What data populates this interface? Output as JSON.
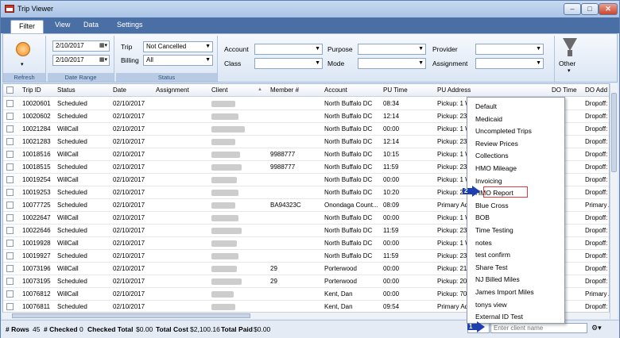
{
  "window": {
    "title": "Trip Viewer",
    "min": "–",
    "max": "□",
    "close": "✕"
  },
  "menu": {
    "tabs": [
      "Filter",
      "View",
      "Data",
      "Settings"
    ]
  },
  "ribbon": {
    "refresh_label": "Refresh",
    "date_from": "2/10/2017",
    "date_to": "2/10/2017",
    "date_range_label": "Date Range",
    "trip_label": "Trip",
    "trip_value": "Not Cancelled",
    "billing_label": "Billing",
    "billing_value": "All",
    "status_label": "Status",
    "account_label": "Account",
    "account_value": "",
    "class_label": "Class",
    "class_value": "",
    "purpose_label": "Purpose",
    "purpose_value": "",
    "mode_label": "Mode",
    "mode_value": "",
    "provider_label": "Provider",
    "provider_value": "",
    "assignment_label": "Assignment",
    "assignment_value": "",
    "other_label": "Other"
  },
  "grid": {
    "columns": [
      "Trip ID",
      "Status",
      "Date",
      "Assignment",
      "Client",
      "Member #",
      "Account",
      "PU Time",
      "PU Address",
      "DO Time",
      "DO Add"
    ],
    "sort_indicator": "▲",
    "rows": [
      {
        "id": "10020601",
        "status": "Scheduled",
        "date": "02/10/2017",
        "member": "",
        "account": "North Buffalo DC",
        "pu_time": "08:34",
        "pu_addr": "Pickup: 1 W",
        "do_addr": "Dropoff:"
      },
      {
        "id": "10020602",
        "status": "Scheduled",
        "date": "02/10/2017",
        "member": "",
        "account": "North Buffalo DC",
        "pu_time": "12:14",
        "pu_addr": "Pickup: 23 (",
        "do_addr": "Dropoff:"
      },
      {
        "id": "10021284",
        "status": "WillCall",
        "date": "02/10/2017",
        "member": "",
        "account": "North Buffalo DC",
        "pu_time": "00:00",
        "pu_addr": "Pickup: 1 W",
        "do_addr": "Dropoff:"
      },
      {
        "id": "10021283",
        "status": "Scheduled",
        "date": "02/10/2017",
        "member": "",
        "account": "North Buffalo DC",
        "pu_time": "12:14",
        "pu_addr": "Pickup: 23 (",
        "do_addr": "Dropoff:"
      },
      {
        "id": "10018516",
        "status": "WillCall",
        "date": "02/10/2017",
        "member": "9988777",
        "account": "North Buffalo DC",
        "pu_time": "10:15",
        "pu_addr": "Pickup: 1 W",
        "do_addr": "Dropoff:"
      },
      {
        "id": "10018515",
        "status": "Scheduled",
        "date": "02/10/2017",
        "member": "9988777",
        "account": "North Buffalo DC",
        "pu_time": "11:59",
        "pu_addr": "Pickup: 23 (",
        "do_addr": "Dropoff:"
      },
      {
        "id": "10019254",
        "status": "WillCall",
        "date": "02/10/2017",
        "member": "",
        "account": "North Buffalo DC",
        "pu_time": "00:00",
        "pu_addr": "Pickup: 1 W",
        "do_addr": "Dropoff:"
      },
      {
        "id": "10019253",
        "status": "Scheduled",
        "date": "02/10/2017",
        "member": "",
        "account": "North Buffalo DC",
        "pu_time": "10:20",
        "pu_addr": "Pickup: 2",
        "do_addr": "Dropoff:"
      },
      {
        "id": "10077725",
        "status": "Scheduled",
        "date": "02/10/2017",
        "member": "BA94323C",
        "account": "Onondaga Count...",
        "pu_time": "08:09",
        "pu_addr": "Primary Add",
        "do_addr": "Primary A"
      },
      {
        "id": "10022647",
        "status": "WillCall",
        "date": "02/10/2017",
        "member": "",
        "account": "North Buffalo DC",
        "pu_time": "00:00",
        "pu_addr": "Pickup: 1 W",
        "do_addr": "Dropoff:"
      },
      {
        "id": "10022646",
        "status": "Scheduled",
        "date": "02/10/2017",
        "member": "",
        "account": "North Buffalo DC",
        "pu_time": "11:59",
        "pu_addr": "Pickup: 23 (",
        "do_addr": "Dropoff:"
      },
      {
        "id": "10019928",
        "status": "WillCall",
        "date": "02/10/2017",
        "member": "",
        "account": "North Buffalo DC",
        "pu_time": "00:00",
        "pu_addr": "Pickup: 1 W",
        "do_addr": "Dropoff:"
      },
      {
        "id": "10019927",
        "status": "Scheduled",
        "date": "02/10/2017",
        "member": "",
        "account": "North Buffalo DC",
        "pu_time": "11:59",
        "pu_addr": "Pickup: 23 (",
        "do_addr": "Dropoff:"
      },
      {
        "id": "10073196",
        "status": "WillCall",
        "date": "02/10/2017",
        "member": "29",
        "account": "Porterwood",
        "pu_time": "00:00",
        "pu_addr": "Pickup: 21",
        "do_addr": "Dropoff:"
      },
      {
        "id": "10073195",
        "status": "Scheduled",
        "date": "02/10/2017",
        "member": "29",
        "account": "Porterwood",
        "pu_time": "00:00",
        "pu_addr": "Pickup: 200",
        "do_addr": "Dropoff:"
      },
      {
        "id": "10076812",
        "status": "WillCall",
        "date": "02/10/2017",
        "member": "",
        "account": "Kent, Dan",
        "pu_time": "00:00",
        "pu_addr": "Pickup: 70",
        "do_addr": "Primary A"
      },
      {
        "id": "10076811",
        "status": "Scheduled",
        "date": "02/10/2017",
        "member": "",
        "account": "Kent, Dan",
        "pu_time": "09:54",
        "pu_addr": "Primary Add",
        "do_addr": "Dropoff:"
      }
    ]
  },
  "context_menu": {
    "items": [
      "Default",
      "Medicaid",
      "Uncompleted Trips",
      "Review Prices",
      "Collections",
      "HMO Mileage",
      "Invoicing",
      "HMO Report",
      "Blue Cross",
      "BOB",
      "Time Testing",
      "notes",
      "test confirm",
      "Share Test",
      "NJ Billed Miles",
      "James Import Miles",
      "tonys view",
      "External ID Test"
    ]
  },
  "annotations": {
    "step1": "1",
    "step2": "2"
  },
  "status": {
    "rows_label": "# Rows",
    "rows_value": "45",
    "checked_label": "# Checked",
    "checked_value": "0",
    "checked_total_label": "Checked Total",
    "checked_total_value": "$0.00",
    "total_cost_label": "Total Cost",
    "total_cost_value": "$2,100.16",
    "total_paid_label": "Total Paid",
    "total_paid_value": "$0.00",
    "client_placeholder": "Enter client name"
  }
}
